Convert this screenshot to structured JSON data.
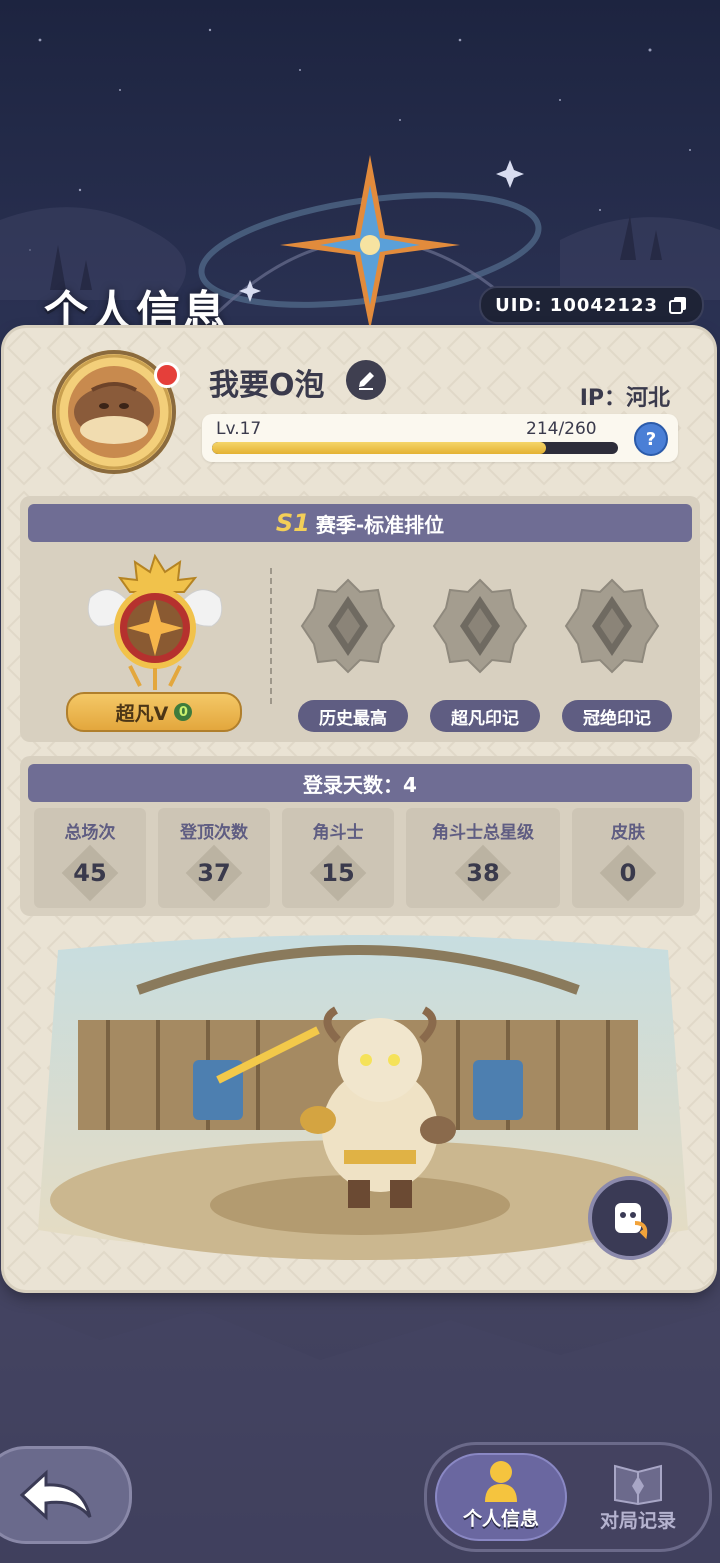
{
  "header": {
    "title": "个人信息",
    "uid_text": "UID: 10042123"
  },
  "profile": {
    "nickname": "我要O泡",
    "ip_text": "IP：河北",
    "level_label": "Lv.17",
    "exp_text": "214/260",
    "exp_progress": 0.823,
    "help_label": "?"
  },
  "season": {
    "badge": "S1",
    "title": "赛季-标准排位",
    "rank_name": "超凡V",
    "rank_stars": "0",
    "marks": [
      {
        "label": "历史最高",
        "icon": "empty-rank-icon"
      },
      {
        "label": "超凡印记",
        "icon": "empty-rank-icon"
      },
      {
        "label": "冠绝印记",
        "icon": "empty-rank-icon"
      }
    ]
  },
  "stats": {
    "login_days_text": "登录天数：4",
    "items": [
      {
        "label": "总场次",
        "value": "45"
      },
      {
        "label": "登顶次数",
        "value": "37"
      },
      {
        "label": "角斗士",
        "value": "15"
      },
      {
        "label": "角斗士总星级",
        "value": "38"
      },
      {
        "label": "皮肤",
        "value": "0"
      }
    ]
  },
  "nav": {
    "tabs": [
      {
        "label": "个人信息",
        "active": true
      },
      {
        "label": "对局记录",
        "active": false
      }
    ]
  },
  "colors": {
    "accent_purple": "#6f6d94",
    "gold": "#f3cf58",
    "card_bg": "#eae3d4"
  }
}
